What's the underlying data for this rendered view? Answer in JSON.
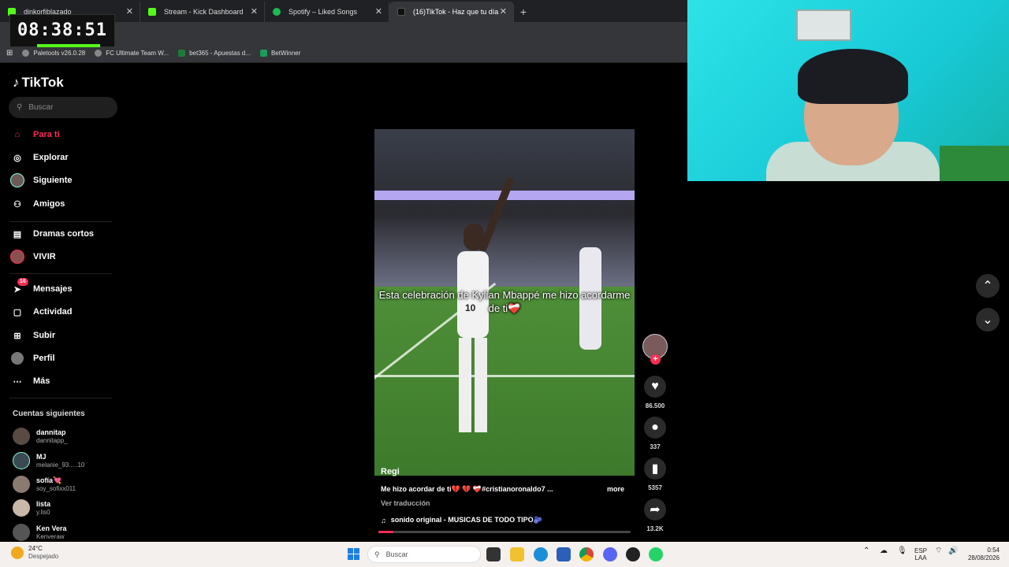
{
  "browser": {
    "tabs": [
      {
        "label": "dinkorfiblazado",
        "active": false
      },
      {
        "label": "Stream - Kick Dashboard",
        "active": false
      },
      {
        "label": "Spotify – Liked Songs",
        "active": false
      },
      {
        "label": "(16)TikTok - Haz que tu día",
        "active": true
      }
    ],
    "new_tab": "+",
    "bookmarks": [
      "Paletools v26.0.28",
      "FC Ultimate Team W...",
      "bet365 - Apuestas d...",
      "BetWinner"
    ]
  },
  "overlay": {
    "timer": "08:38:51"
  },
  "tiktok": {
    "logo": "TikTok",
    "search_placeholder": "Buscar",
    "nav": [
      {
        "label": "Para ti",
        "icon": "home-icon"
      },
      {
        "label": "Explorar",
        "icon": "compass-icon"
      },
      {
        "label": "Siguiente",
        "icon": "avatar-icon"
      },
      {
        "label": "Amigos",
        "icon": "friends-icon"
      },
      {
        "label": "Dramas cortos",
        "icon": "film-icon"
      },
      {
        "label": "VIVIR",
        "icon": "live-icon"
      },
      {
        "label": "Mensajes",
        "icon": "messages-icon",
        "badge": "16"
      },
      {
        "label": "Actividad",
        "icon": "activity-icon"
      },
      {
        "label": "Subir",
        "icon": "upload-icon"
      },
      {
        "label": "Perfil",
        "icon": "profile-icon"
      },
      {
        "label": "Más",
        "icon": "more-icon"
      }
    ],
    "following_title": "Cuentas siguientes",
    "following": [
      {
        "name": "dannitap",
        "handle": "dannitapp_"
      },
      {
        "name": "MJ",
        "handle": "melanie_93.....10"
      },
      {
        "name": "sofía💘",
        "handle": "soy_sofixx011"
      },
      {
        "name": "lista",
        "handle": "y.lis0"
      },
      {
        "name": "Ken Vera",
        "handle": "Kenveraw"
      }
    ]
  },
  "video": {
    "caption": "Esta celebración de Kylian Mbappé me hizo acordarme de ti❤️‍🩹",
    "jersey_number": "10",
    "username": "Regi",
    "description": "Me hizo acordar de ti💔 💔 ❤️‍🩹#cristianoronaldo7 ...",
    "more": "more",
    "translate": "Ver traducción",
    "sound": "sonido original - MUSICAS DE TODO TIPO🫐",
    "progress_pct": 6,
    "likes": "86.500",
    "comments": "337",
    "saves": "5357",
    "shares": "13.2K"
  },
  "taskbar": {
    "weather_temp": "24°C",
    "weather_desc": "Despejado",
    "search": "Buscar",
    "lang_1": "ESP",
    "lang_2": "LAA",
    "time": "0:54",
    "date": "28/08/2026"
  },
  "colors": {
    "accent": "#fe2c55",
    "kick": "#53fc18",
    "spotify": "#1db954"
  }
}
